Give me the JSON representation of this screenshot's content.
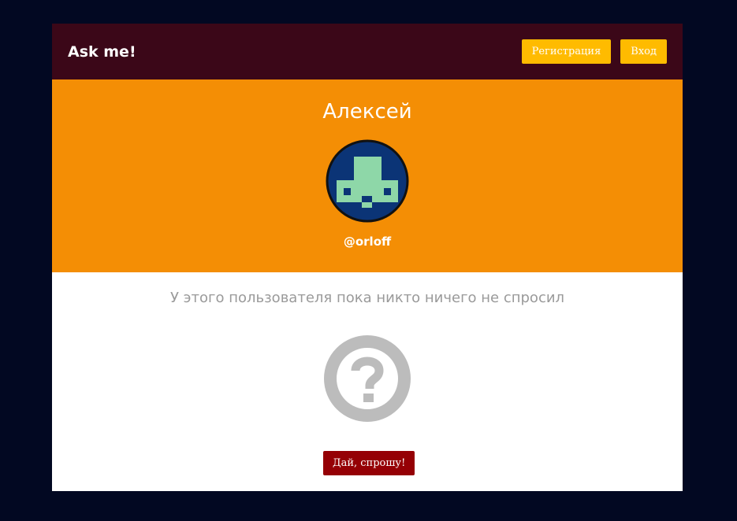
{
  "header": {
    "logo": "Ask me!",
    "register_label": "Регистрация",
    "login_label": "Вход"
  },
  "profile": {
    "name": "Алексей",
    "nickname": "@orloff",
    "avatar_icon": "pixel-avatar-icon"
  },
  "questions": {
    "empty_text": "У этого пользователя пока никто ничего не спросил",
    "empty_icon": "question-circle-icon",
    "ask_button_label": "Дай, спрошу!"
  },
  "colors": {
    "page_background": "#020822",
    "header_background": "#3b0718",
    "profile_background": "#f48e05",
    "button_yellow": "#ffbb00",
    "button_red": "#950005",
    "avatar_background": "#0b3476",
    "avatar_figure": "#8ed7a8",
    "muted_gray": "#bcbcbc"
  }
}
